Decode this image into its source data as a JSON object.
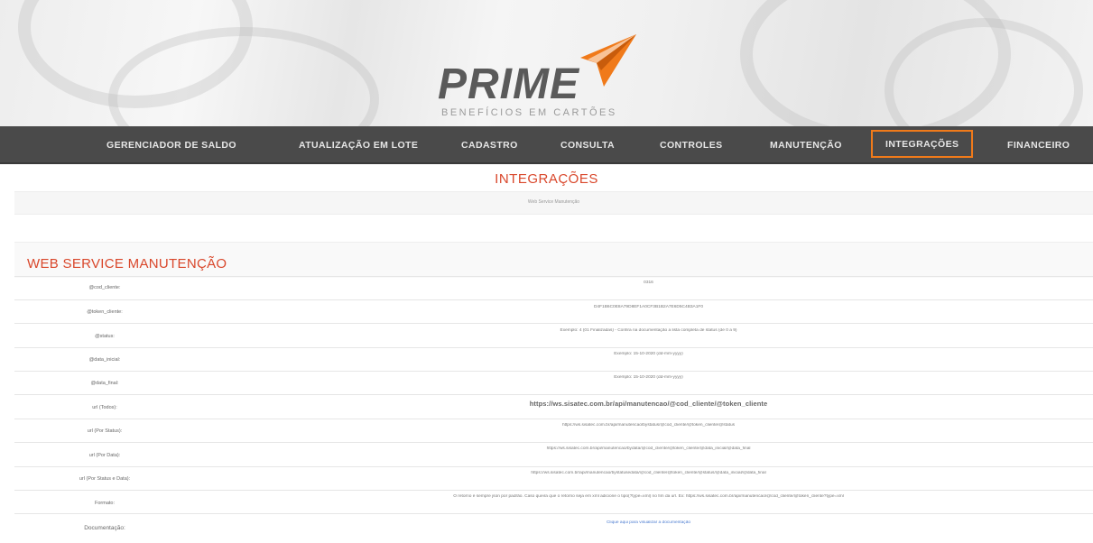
{
  "header": {
    "logo_word": "PRIME",
    "logo_sub": "BENEFÍCIOS EM CARTÕES",
    "accent": "#f07a1a"
  },
  "nav": {
    "items": [
      {
        "label": "GERENCIADOR DE SALDO",
        "active": false
      },
      {
        "label": "ATUALIZAÇÃO EM LOTE",
        "active": false
      },
      {
        "label": "CADASTRO",
        "active": false
      },
      {
        "label": "CONSULTA",
        "active": false
      },
      {
        "label": "CONTROLES",
        "active": false
      },
      {
        "label": "MANUTENÇÃO",
        "active": false
      },
      {
        "label": "INTEGRAÇÕES",
        "active": true
      },
      {
        "label": "FINANCEIRO",
        "active": false
      }
    ]
  },
  "page": {
    "title": "INTEGRAÇÕES",
    "breadcrumb": "Web Service Manutenção"
  },
  "section": {
    "title": "WEB SERVICE MANUTENÇÃO"
  },
  "rows": [
    {
      "label": "@cod_cliente:",
      "value": "0316"
    },
    {
      "label": "@token_cliente:",
      "value": "D4F1B6C0E8A79D8EF1A0CF3B1B2A7E6D5C4B3A1F0"
    },
    {
      "label": "@status:",
      "value": "Exemplo: 4 (01 Finalizadas) - Confira na documentação a lista completa de status (de 0 a 9)"
    },
    {
      "label": "@data_inicial:",
      "value": "Exemplo: 15-10-2020 (dd-mm-yyyy)"
    },
    {
      "label": "@data_final:",
      "value": "Exemplo: 15-10-2020 (dd-mm-yyyy)"
    },
    {
      "label": "url (Todos):",
      "value": "https://ws.sisatec.com.br/api/manutencao/@cod_cliente/@token_cliente"
    },
    {
      "label": "url (Por Status):",
      "value": "https://ws.sisatec.com.br/api/manutencao/bystatus/@cod_cliente/@token_cliente/@status"
    },
    {
      "label": "url (Por Data):",
      "value": "https://ws.sisatec.com.br/api/manutencao/bydata/@cod_cliente/@token_cliente/@data_inicial/@data_final"
    },
    {
      "label": "url (Por Status e Data):",
      "value": "https://ws.sisatec.com.br/api/manutencao/bystatusedata/@cod_cliente/@token_cliente/@status/@data_inicial/@data_final"
    },
    {
      "label": "Formato:",
      "value": "O retorno é sempre json por padrão. Caso queira que o retorno seja em xml adicione o tipo(?type=xml) no fim da url. Ex: https://ws.sisatec.com.br/api/manutencao/@cod_cliente/@token_cliente?type=xml"
    },
    {
      "label": "Documentação:",
      "value": "Clique aqui para visualizar a documentação"
    }
  ]
}
